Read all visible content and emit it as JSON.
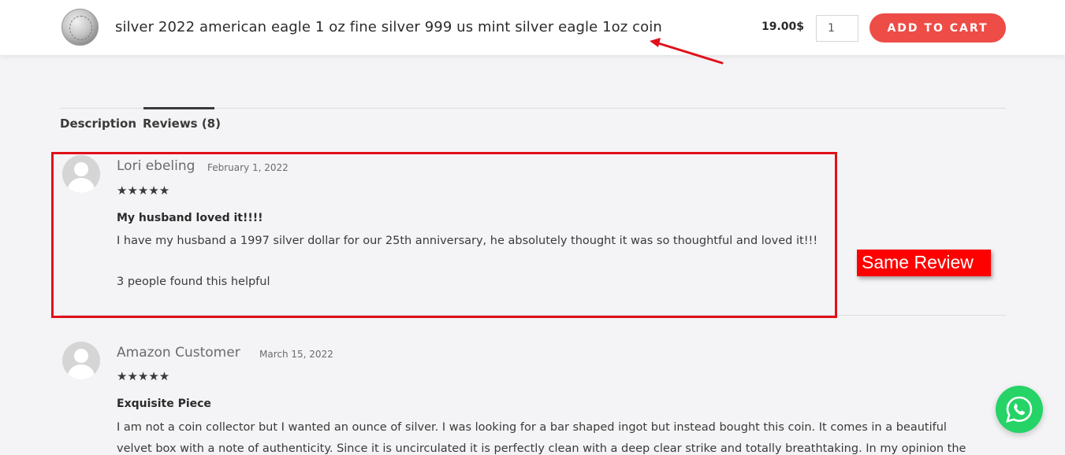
{
  "sticky_bar": {
    "product_title": "silver 2022 american eagle 1 oz fine silver 999 us mint silver eagle 1oz coin",
    "price": "19.00$",
    "quantity": "1",
    "add_to_cart_label": "ADD TO CART",
    "thumbnail_icon": "silver-coin-icon"
  },
  "tabs": [
    {
      "label": "Description",
      "active": false
    },
    {
      "label": "Reviews (8)",
      "active": true
    }
  ],
  "reviews": [
    {
      "author": "Lori ebeling",
      "date": "February 1, 2022",
      "rating": 5,
      "stars": "★★★★★",
      "title": "My husband loved it!!!!",
      "body": "I have my husband a 1997 silver dollar for our 25th anniversary, he absolutely thought it was so thoughtful and loved it!!!",
      "helpful": "3 people found this helpful"
    },
    {
      "author": "Amazon Customer",
      "date": "March 15, 2022",
      "rating": 5,
      "stars": "★★★★★",
      "title": "Exquisite Piece",
      "body": "I am not a coin collector but I wanted an ounce of silver. I was looking for a bar shaped ingot but instead bought this coin. It comes in a beautiful velvet box with a note of authenticity. Since it is uncirculated it is perfectly clean with a deep clear strike and totally breathtaking. In my opinion the"
    }
  ],
  "annotation": {
    "label": "Same Review",
    "color": "#ff0000"
  },
  "whatsapp": {
    "icon": "whatsapp-icon",
    "color": "#25d366"
  },
  "colors": {
    "accent": "#ee4c47",
    "highlight": "#e0101a"
  }
}
